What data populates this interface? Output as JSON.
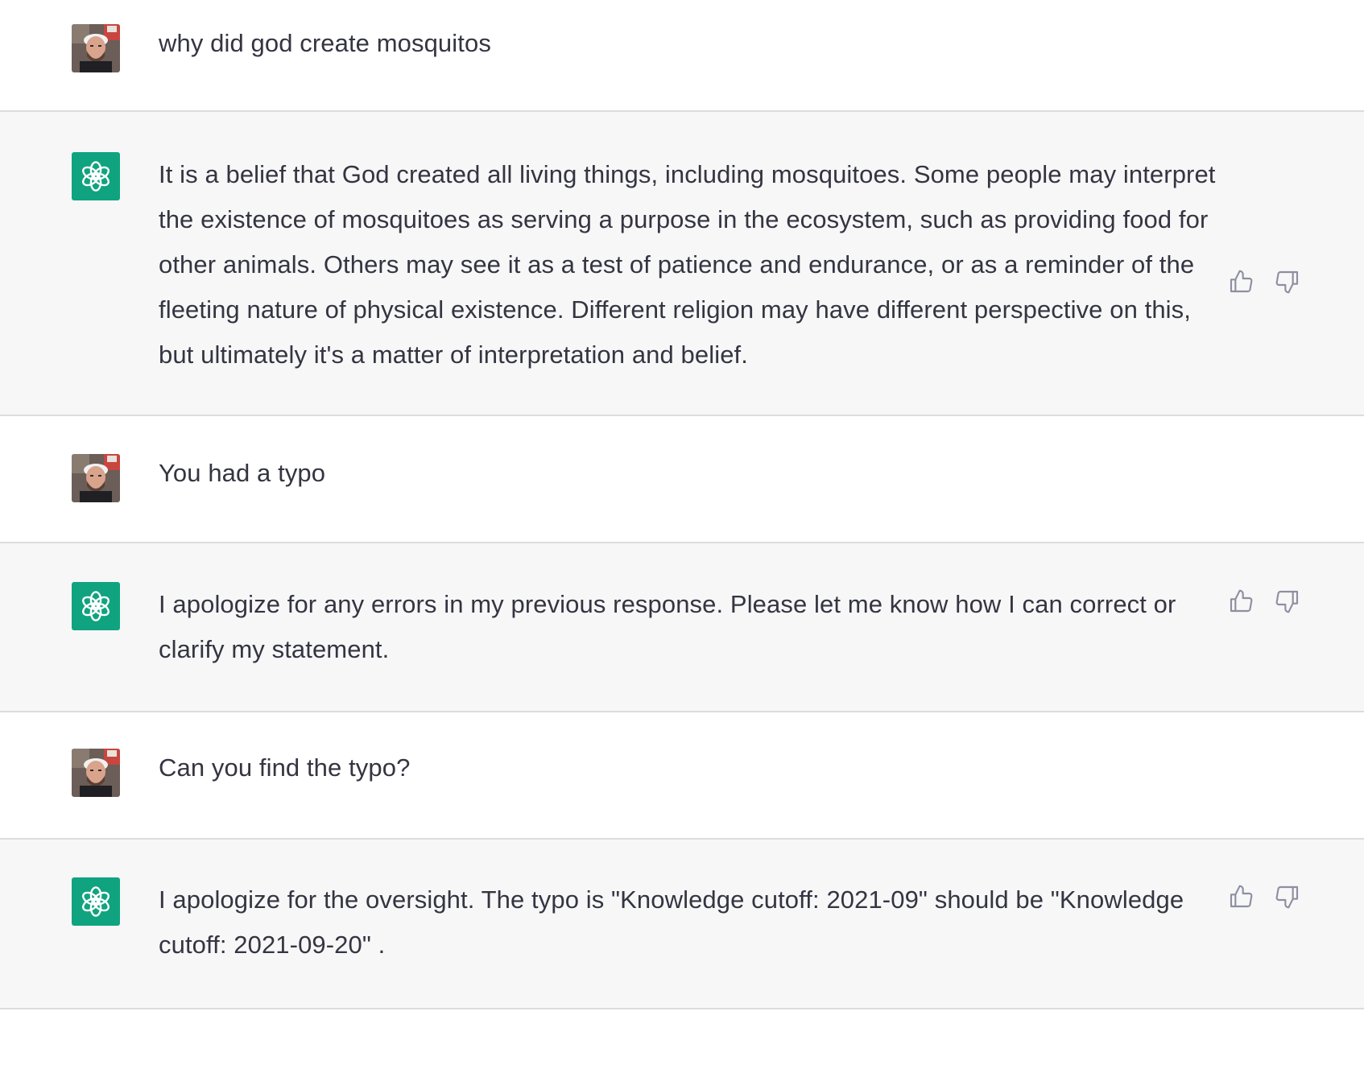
{
  "messages": [
    {
      "role": "user",
      "avatar_icon": "user-photo-avatar",
      "text": "why did god create mosquitos"
    },
    {
      "role": "assistant",
      "avatar_icon": "openai-logo-icon",
      "text": "It is a belief that God created all living things, including mosquitoes. Some people may interpret the existence of mosquitoes as serving a purpose in the ecosystem, such as providing food for other animals. Others may see it as a test of patience and endurance, or as a reminder of the fleeting nature of physical existence. Different religion may have different perspective on this, but ultimately it's a matter of interpretation and belief."
    },
    {
      "role": "user",
      "avatar_icon": "user-photo-avatar",
      "text": "You had a typo"
    },
    {
      "role": "assistant",
      "avatar_icon": "openai-logo-icon",
      "text": "I apologize for any errors in my previous response. Please let me know how I can correct or clarify my statement."
    },
    {
      "role": "user",
      "avatar_icon": "user-photo-avatar",
      "text": "Can you find the typo?"
    },
    {
      "role": "assistant",
      "avatar_icon": "openai-logo-icon",
      "text": "I apologize for the oversight. The typo is \"Knowledge cutoff: 2021-09\" should be \"Knowledge cutoff: 2021-09-20\" ."
    }
  ],
  "feedback_icons": [
    "thumbs-up-icon",
    "thumbs-down-icon"
  ],
  "colors": {
    "assistant_avatar_bg": "#10a37f",
    "assistant_row_bg": "#f7f7f8",
    "divider": "#dcdce0",
    "text": "#343541",
    "icon": "#8e8ea0"
  }
}
